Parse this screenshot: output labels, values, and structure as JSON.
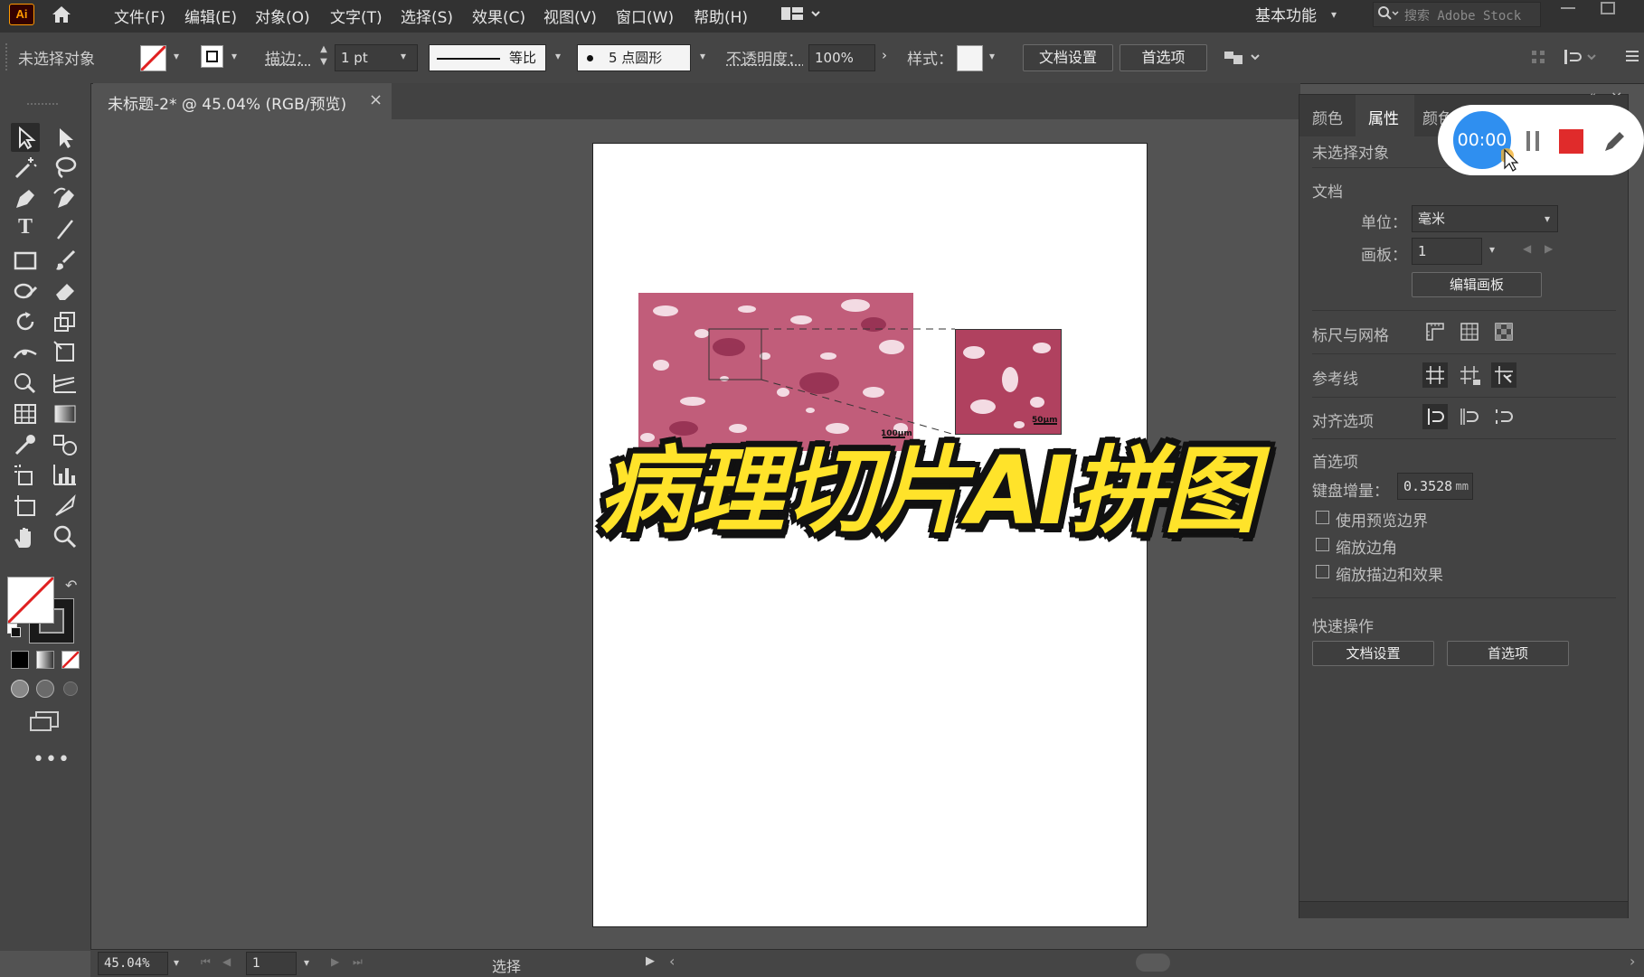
{
  "app": {
    "logo": "Ai"
  },
  "menu": [
    "文件(F)",
    "编辑(E)",
    "对象(O)",
    "文字(T)",
    "选择(S)",
    "效果(C)",
    "视图(V)",
    "窗口(W)",
    "帮助(H)"
  ],
  "workspace": {
    "label": "基本功能",
    "search_placeholder": "搜索 Adobe Stock"
  },
  "control": {
    "selection": "未选择对象",
    "stroke_label": "描边：",
    "stroke_value": "1 pt",
    "line_style": "等比",
    "brush": "5 点圆形",
    "opacity_label": "不透明度：",
    "opacity_value": "100%",
    "style_label": "样式：",
    "doc_setup": "文档设置",
    "preferences": "首选项"
  },
  "doc_tab": {
    "title": "未标题-2* @ 45.04% (RGB/预览)",
    "close": "×"
  },
  "canvas": {
    "scale_big": "100μm",
    "scale_small": "50μm"
  },
  "overlay_title": "病理切片AI拼图",
  "recorder": {
    "time": "00:00"
  },
  "panel": {
    "tabs": [
      "颜色",
      "属性",
      "颜色"
    ],
    "selection": "未选择对象",
    "doc_section": "文档",
    "unit_label": "单位：",
    "unit_value": "毫米",
    "artboard_label": "画板：",
    "artboard_value": "1",
    "edit_artboard": "编辑画板",
    "rulers_grid": "标尺与网格",
    "guides": "参考线",
    "snap_options": "对齐选项",
    "prefs_section": "首选项",
    "keyboard_increment_label": "键盘增量：",
    "keyboard_increment_value": "0.3528",
    "keyboard_increment_unit": "mm",
    "checks": [
      "使用预览边界",
      "缩放边角",
      "缩放描边和效果"
    ],
    "quick_actions": "快速操作",
    "qa_doc_setup": "文档设置",
    "qa_preferences": "首选项"
  },
  "status": {
    "zoom": "45.04%",
    "artboard": "1",
    "tool": "选择"
  }
}
